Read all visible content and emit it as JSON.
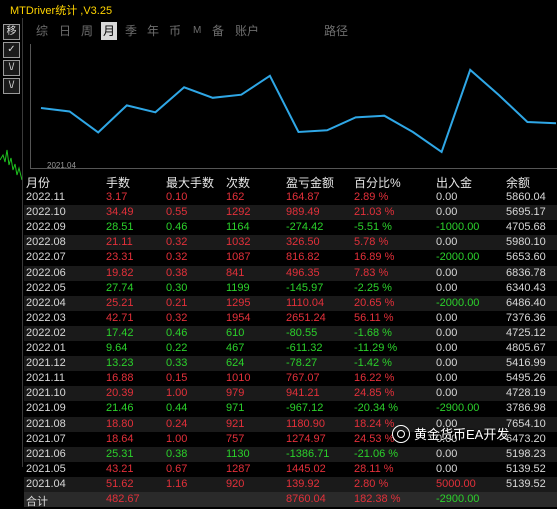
{
  "window": {
    "title": "MTDriver统计 ,V3.25"
  },
  "sidebar": {
    "buttons": [
      {
        "label": "移",
        "icon": "move-icon"
      },
      {
        "label": "✓",
        "icon": "check-icon"
      },
      {
        "label": "\\/",
        "icon": "chevron-down-icon"
      },
      {
        "label": "\\/",
        "icon": "chevron-down-icon"
      }
    ]
  },
  "tabs": [
    "综",
    "日",
    "周",
    "月",
    "季",
    "年",
    "币",
    "M",
    "备",
    "账户",
    "路径"
  ],
  "active_tab": "月",
  "chart_data": {
    "type": "line",
    "x": [
      "2021.04",
      "2021.05",
      "2021.06",
      "2021.07",
      "2021.08",
      "2021.09",
      "2021.10",
      "2021.11",
      "2021.12",
      "2022.01",
      "2022.02",
      "2022.03",
      "2022.04",
      "2022.05",
      "2022.06",
      "2022.07",
      "2022.08",
      "2022.09",
      "2022.10",
      "2022.11"
    ],
    "values": [
      5139.52,
      5198.23,
      6473.2,
      7654.1,
      3786.98,
      4728.19,
      5495.26,
      5416.99,
      4805.67,
      4725.12,
      7376.36,
      6486.4,
      6340.43,
      6836.78,
      5653.6,
      5980.1,
      4705.68,
      5695.17,
      5860.04
    ],
    "x_tick_label": "2021.04",
    "line_color": "#2fa7e6",
    "grid": false
  },
  "table": {
    "headers": [
      "月份",
      "手数",
      "最大手数",
      "次数",
      "盈亏金额",
      "百分比%",
      "出入金",
      "余额"
    ],
    "rows": [
      [
        "2022.11",
        "3.17",
        "0.10",
        "162",
        "164.87",
        "2.89 %",
        "0.00",
        "5860.04"
      ],
      [
        "2022.10",
        "34.49",
        "0.55",
        "1292",
        "989.49",
        "21.03 %",
        "0.00",
        "5695.17"
      ],
      [
        "2022.09",
        "28.51",
        "0.46",
        "1164",
        "-274.42",
        "-5.51 %",
        "-1000.00",
        "4705.68"
      ],
      [
        "2022.08",
        "21.11",
        "0.32",
        "1032",
        "326.50",
        "5.78 %",
        "0.00",
        "5980.10"
      ],
      [
        "2022.07",
        "23.31",
        "0.32",
        "1087",
        "816.82",
        "16.89 %",
        "-2000.00",
        "5653.60"
      ],
      [
        "2022.06",
        "19.82",
        "0.38",
        "841",
        "496.35",
        "7.83 %",
        "0.00",
        "6836.78"
      ],
      [
        "2022.05",
        "27.74",
        "0.30",
        "1199",
        "-145.97",
        "-2.25 %",
        "0.00",
        "6340.43"
      ],
      [
        "2022.04",
        "25.21",
        "0.21",
        "1295",
        "1110.04",
        "20.65 %",
        "-2000.00",
        "6486.40"
      ],
      [
        "2022.03",
        "42.71",
        "0.32",
        "1954",
        "2651.24",
        "56.11 %",
        "0.00",
        "7376.36"
      ],
      [
        "2022.02",
        "17.42",
        "0.46",
        "610",
        "-80.55",
        "-1.68 %",
        "0.00",
        "4725.12"
      ],
      [
        "2022.01",
        "9.64",
        "0.22",
        "467",
        "-611.32",
        "-11.29 %",
        "0.00",
        "4805.67"
      ],
      [
        "2021.12",
        "13.23",
        "0.33",
        "624",
        "-78.27",
        "-1.42 %",
        "0.00",
        "5416.99"
      ],
      [
        "2021.11",
        "16.88",
        "0.15",
        "1010",
        "767.07",
        "16.22 %",
        "0.00",
        "5495.26"
      ],
      [
        "2021.10",
        "20.39",
        "1.00",
        "979",
        "941.21",
        "24.85 %",
        "0.00",
        "4728.19"
      ],
      [
        "2021.09",
        "21.46",
        "0.44",
        "971",
        "-967.12",
        "-20.34 %",
        "-2900.00",
        "3786.98"
      ],
      [
        "2021.08",
        "18.80",
        "0.24",
        "921",
        "1180.90",
        "18.24 %",
        "0.00",
        "7654.10"
      ],
      [
        "2021.07",
        "18.64",
        "1.00",
        "757",
        "1274.97",
        "24.53 %",
        "0.00",
        "6473.20"
      ],
      [
        "2021.06",
        "25.31",
        "0.38",
        "1130",
        "-1386.71",
        "-21.06 %",
        "0.00",
        "5198.23"
      ],
      [
        "2021.05",
        "43.21",
        "0.67",
        "1287",
        "1445.02",
        "28.11 %",
        "0.00",
        "5139.52"
      ],
      [
        "2021.04",
        "51.62",
        "1.16",
        "920",
        "139.92",
        "2.80 %",
        "5000.00",
        "5139.52"
      ]
    ],
    "total": [
      "合计",
      "482.67",
      "",
      "",
      "8760.04",
      "182.38 %",
      "-2900.00",
      ""
    ]
  },
  "watermark": "黄金货币EA开发",
  "colors": {
    "positive": "#e3303a",
    "negative": "#2bd12b",
    "title": "#ffd400"
  }
}
